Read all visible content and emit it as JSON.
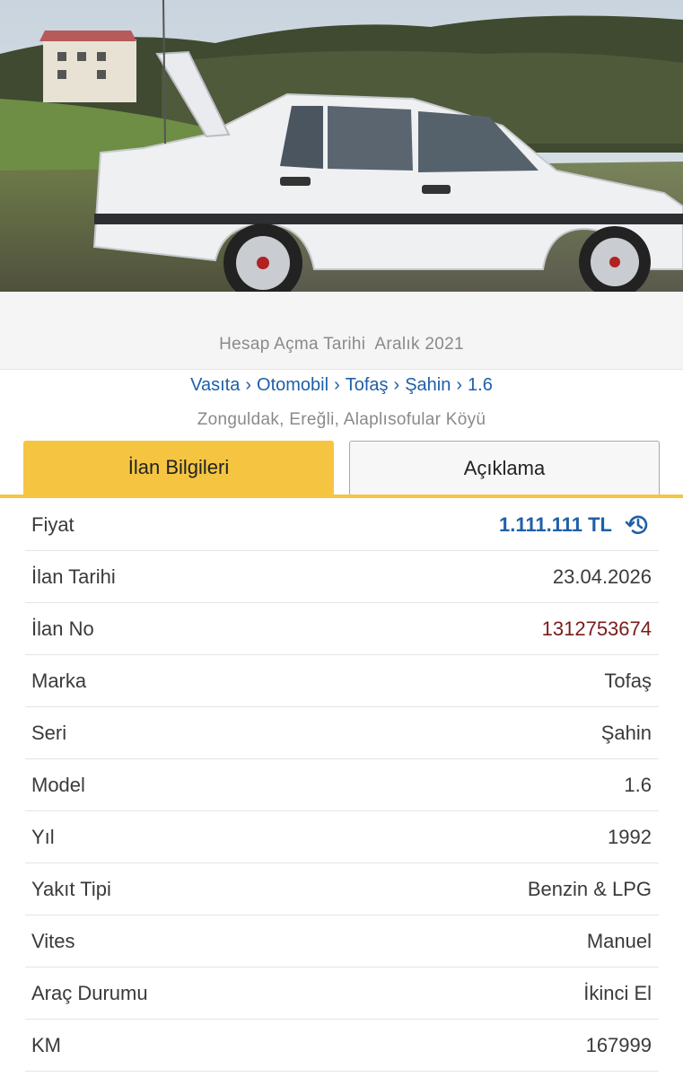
{
  "header": {
    "account_date_label": "Hesap Açma Tarihi",
    "account_date_value": "Aralık 2021"
  },
  "breadcrumb": {
    "items": [
      "Vasıta",
      "Otomobil",
      "Tofaş",
      "Şahin",
      "1.6"
    ],
    "separator": "›"
  },
  "location": "Zonguldak, Ereğli, Alaplısofular Köyü",
  "tabs": {
    "info_label": "İlan Bilgileri",
    "description_label": "Açıklama",
    "active": "info"
  },
  "details": [
    {
      "label": "Fiyat",
      "value": "1.111.111 TL"
    },
    {
      "label": "İlan Tarihi",
      "value": "23.04.2026"
    },
    {
      "label": "İlan No",
      "value": "1312753674"
    },
    {
      "label": "Marka",
      "value": "Tofaş"
    },
    {
      "label": "Seri",
      "value": "Şahin"
    },
    {
      "label": "Model",
      "value": "1.6"
    },
    {
      "label": "Yıl",
      "value": "1992"
    },
    {
      "label": "Yakıt Tipi",
      "value": "Benzin & LPG"
    },
    {
      "label": "Vites",
      "value": "Manuel"
    },
    {
      "label": "Araç Durumu",
      "value": "İkinci El"
    },
    {
      "label": "KM",
      "value": "167999"
    }
  ],
  "colors": {
    "accent": "#f5c542",
    "link": "#1f5fa8",
    "ad_number": "#7a1b1b"
  },
  "icons": {
    "price_history": "history-icon"
  }
}
